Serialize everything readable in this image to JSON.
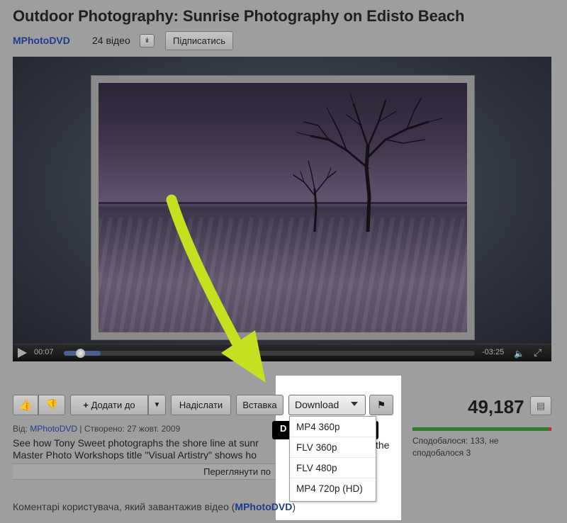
{
  "header": {
    "title": "Outdoor Photography: Sunrise Photography on Edisto Beach",
    "channel": "MPhotoDVD",
    "videos_count": "24 відео",
    "videos_toggle_icon": "chevron-down",
    "subscribe_label": "Підписатись"
  },
  "player": {
    "current_time": "00:07",
    "remaining_time": "-03:25",
    "progress_fraction": 0.03,
    "icons": [
      "play-icon",
      "volume-icon",
      "fullscreen-icon"
    ]
  },
  "actions": {
    "like_icon": "thumbs-up",
    "dislike_icon": "thumbs-down",
    "add_to_label": "Додати до",
    "share_label": "Надіслати",
    "embed_label": "Вставка",
    "download_label": "Download",
    "flag_icon": "flag",
    "tooltip_letter": "D"
  },
  "download_menu": {
    "items": [
      "MP4 360p",
      "FLV 360p",
      "FLV 480p",
      "MP4 720p (HD)"
    ]
  },
  "stats": {
    "views": "49,187",
    "likes_text": "Сподобалося: 133, не сподобалося 3",
    "like_fraction": 0.978,
    "stats_icon": "chart-icon"
  },
  "description": {
    "from_label": "Від:",
    "author": "MPhotoDVD",
    "created": "| Створено: 27 жовт. 2009",
    "text": "See how Tony Sweet photographs the shore line at sunr",
    "text_line2": "Master Photo Workshops title \"Visual Artistry\" shows ho",
    "text_right": "the",
    "more_label": "Переглянути по"
  },
  "comments": {
    "prefix": "Коментарі користувача, який завантажив відео (",
    "author": "MPhotoDVD",
    "suffix": ")"
  },
  "colors": {
    "link": "#1f3b8e",
    "highlight": "#ffffff",
    "arrow": "#c4e021",
    "like_bar": "#2d7d2d"
  }
}
